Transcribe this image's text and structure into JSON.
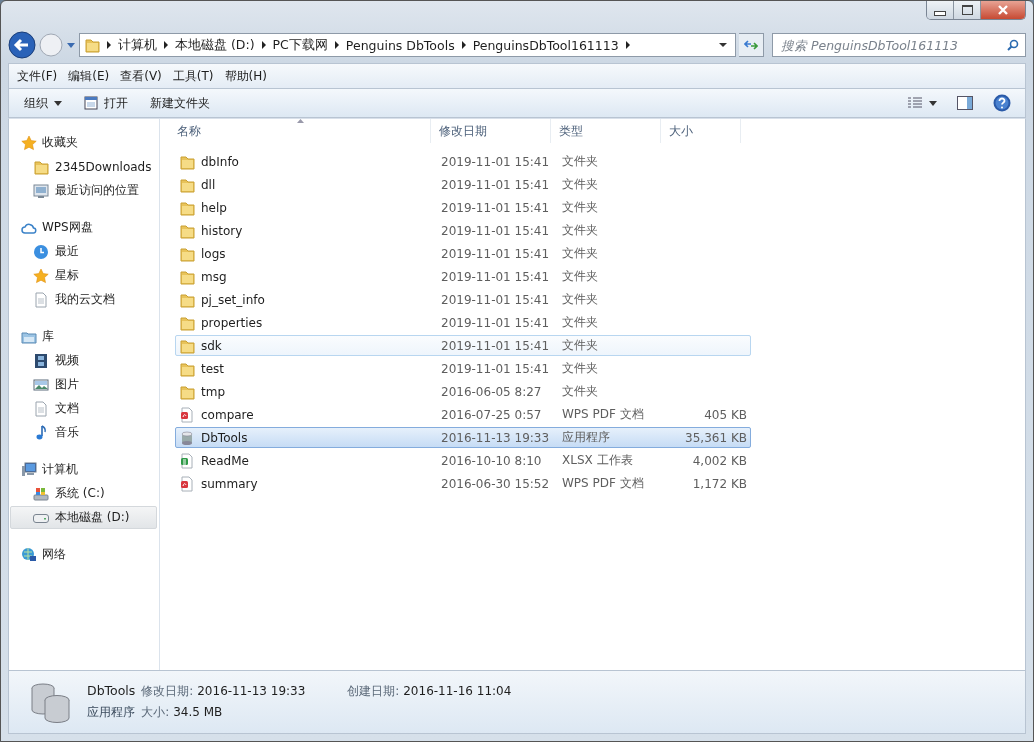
{
  "address_bar": {
    "path": [
      "计算机",
      "本地磁盘 (D:)",
      "PC下载网",
      "Penguins DbTools",
      "PenguinsDbTool161113"
    ]
  },
  "search": {
    "placeholder": "搜索 PenguinsDbTool161113"
  },
  "menu_bar": [
    "文件(F)",
    "编辑(E)",
    "查看(V)",
    "工具(T)",
    "帮助(H)"
  ],
  "toolbar": [
    {
      "label": "组织",
      "kind": "dropdown"
    },
    {
      "label": "打开",
      "kind": "open"
    },
    {
      "label": "新建文件夹",
      "kind": "plain"
    }
  ],
  "sidebar": {
    "groups": [
      {
        "label": "收藏夹",
        "kind": "star",
        "items": [
          {
            "label": "2345Downloads",
            "kind": "folder",
            "selected": false
          },
          {
            "label": "最近访问的位置",
            "kind": "recent",
            "selected": false
          }
        ]
      },
      {
        "label": "WPS网盘",
        "kind": "cloud",
        "items": [
          {
            "label": "最近",
            "kind": "clock",
            "selected": false
          },
          {
            "label": "星标",
            "kind": "star",
            "selected": false
          },
          {
            "label": "我的云文档",
            "kind": "doc",
            "selected": false
          }
        ]
      },
      {
        "label": "库",
        "kind": "library",
        "items": [
          {
            "label": "视频",
            "kind": "video",
            "selected": false
          },
          {
            "label": "图片",
            "kind": "picture",
            "selected": false
          },
          {
            "label": "文档",
            "kind": "doc",
            "selected": false
          },
          {
            "label": "音乐",
            "kind": "music",
            "selected": false
          }
        ]
      },
      {
        "label": "计算机",
        "kind": "computer",
        "items": [
          {
            "label": "系统 (C:)",
            "kind": "system-drive",
            "selected": false
          },
          {
            "label": "本地磁盘 (D:)",
            "kind": "drive",
            "selected": true
          }
        ]
      },
      {
        "label": "网络",
        "kind": "network"
      }
    ]
  },
  "file_list": {
    "columns": [
      "名称",
      "修改日期",
      "类型",
      "大小"
    ],
    "rows": [
      {
        "name": "dbInfo",
        "date": "2019-11-01 15:41",
        "type": "文件夹",
        "kind": "folder",
        "selected": false,
        "hot": false
      },
      {
        "name": "dll",
        "date": "2019-11-01 15:41",
        "type": "文件夹",
        "kind": "folder",
        "selected": false,
        "hot": false
      },
      {
        "name": "help",
        "date": "2019-11-01 15:41",
        "type": "文件夹",
        "kind": "folder",
        "selected": false,
        "hot": false
      },
      {
        "name": "history",
        "date": "2019-11-01 15:41",
        "type": "文件夹",
        "kind": "folder",
        "selected": false,
        "hot": false
      },
      {
        "name": "logs",
        "date": "2019-11-01 15:41",
        "type": "文件夹",
        "kind": "folder",
        "selected": false,
        "hot": false
      },
      {
        "name": "msg",
        "date": "2019-11-01 15:41",
        "type": "文件夹",
        "kind": "folder",
        "selected": false,
        "hot": false
      },
      {
        "name": "pj_set_info",
        "date": "2019-11-01 15:41",
        "type": "文件夹",
        "kind": "folder",
        "selected": false,
        "hot": false
      },
      {
        "name": "properties",
        "date": "2019-11-01 15:41",
        "type": "文件夹",
        "kind": "folder",
        "selected": false,
        "hot": false
      },
      {
        "name": "sdk",
        "date": "2019-11-01 15:41",
        "type": "文件夹",
        "kind": "folder",
        "selected": false,
        "hot": true
      },
      {
        "name": "test",
        "date": "2019-11-01 15:41",
        "type": "文件夹",
        "kind": "folder",
        "selected": false,
        "hot": false
      },
      {
        "name": "tmp",
        "date": "2016-06-05 8:27",
        "type": "文件夹",
        "kind": "folder",
        "selected": false,
        "hot": false
      },
      {
        "name": "compare",
        "date": "2016-07-25 0:57",
        "type": "WPS PDF 文档",
        "size": "405 KB",
        "kind": "pdf",
        "selected": false,
        "hot": false
      },
      {
        "name": "DbTools",
        "date": "2016-11-13 19:33",
        "type": "应用程序",
        "size": "35,361 KB",
        "kind": "app",
        "selected": true,
        "hot": false
      },
      {
        "name": "ReadMe",
        "date": "2016-10-10 8:10",
        "type": "XLSX 工作表",
        "size": "4,002 KB",
        "kind": "sheet",
        "selected": false,
        "hot": false
      },
      {
        "name": "summary",
        "date": "2016-06-30 15:52",
        "type": "WPS PDF 文档",
        "size": "1,172 KB",
        "kind": "pdf",
        "selected": false,
        "hot": false
      }
    ]
  },
  "details": {
    "name": "DbTools",
    "type": "应用程序",
    "fields": [
      {
        "label": "修改日期:",
        "value": "2016-11-13 19:33"
      },
      {
        "label": "大小:",
        "value": "34.5 MB"
      },
      {
        "label": "创建日期:",
        "value": "2016-11-16 11:04"
      }
    ]
  }
}
